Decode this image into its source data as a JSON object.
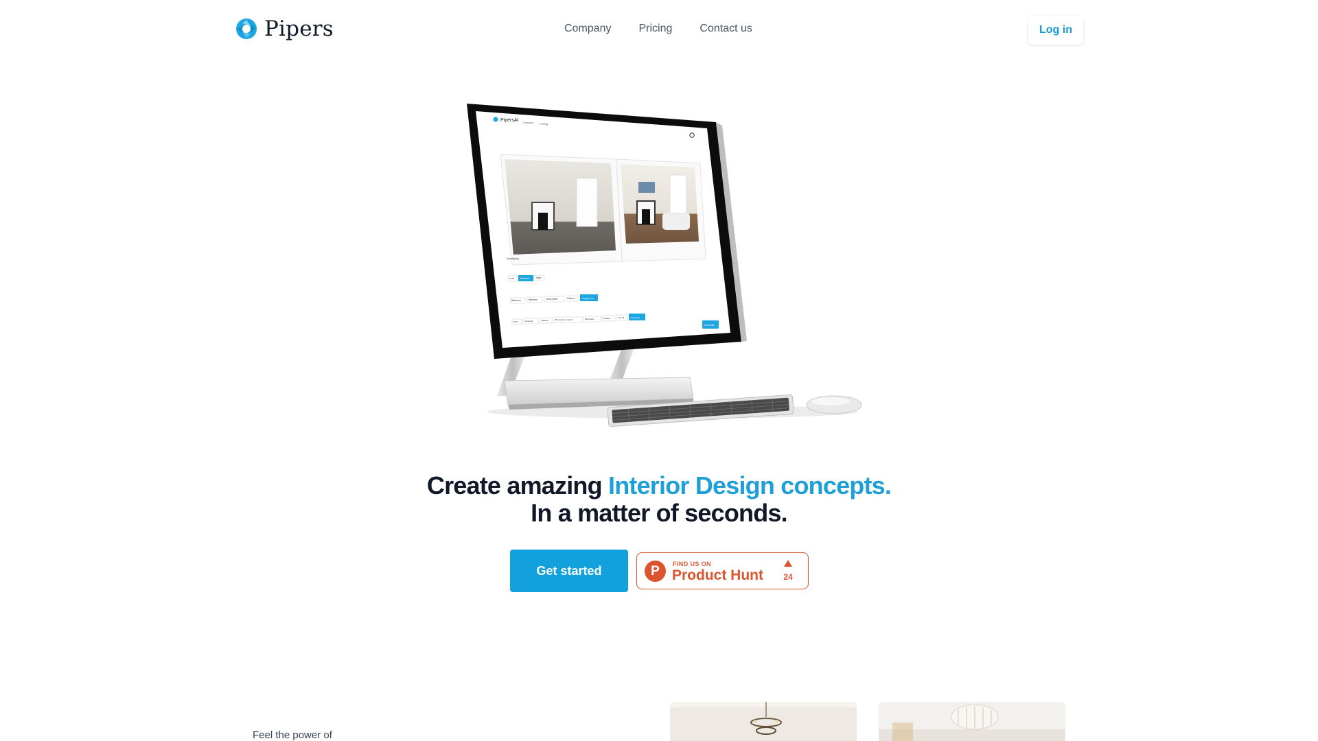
{
  "brand": {
    "name": "Pipers",
    "accent_color": "#1e9fd8"
  },
  "nav": {
    "items": [
      {
        "label": "Company"
      },
      {
        "label": "Pricing"
      },
      {
        "label": "Contact us"
      }
    ],
    "login_label": "Log in"
  },
  "hero": {
    "headline_part1": "Create amazing ",
    "headline_accent": "Interior Design concepts.",
    "headline_line2": "In a matter of seconds.",
    "cta_label": "Get started"
  },
  "product_hunt": {
    "kicker": "FIND US ON",
    "name": "Product Hunt",
    "logo_letter": "P",
    "upvotes": "24",
    "color": "#da552f"
  },
  "screen_ui": {
    "brand": "PipersAI",
    "nav": [
      "Company",
      "Pricing"
    ],
    "input_label": "Input jpeg",
    "freedom_options": [
      "Low",
      "Medium",
      "High"
    ],
    "room_types": [
      "Bathroom",
      "Bedroom",
      "Home office",
      "Kitchen",
      "Living room"
    ],
    "room_styles": [
      "Boho",
      "Industrial",
      "Japandi",
      "Mid-century modern",
      "Minimalist",
      "Modern",
      "Scandi",
      "Traditional"
    ],
    "generate_label": "Generate"
  },
  "section": {
    "feel_text": "Feel the power of"
  }
}
